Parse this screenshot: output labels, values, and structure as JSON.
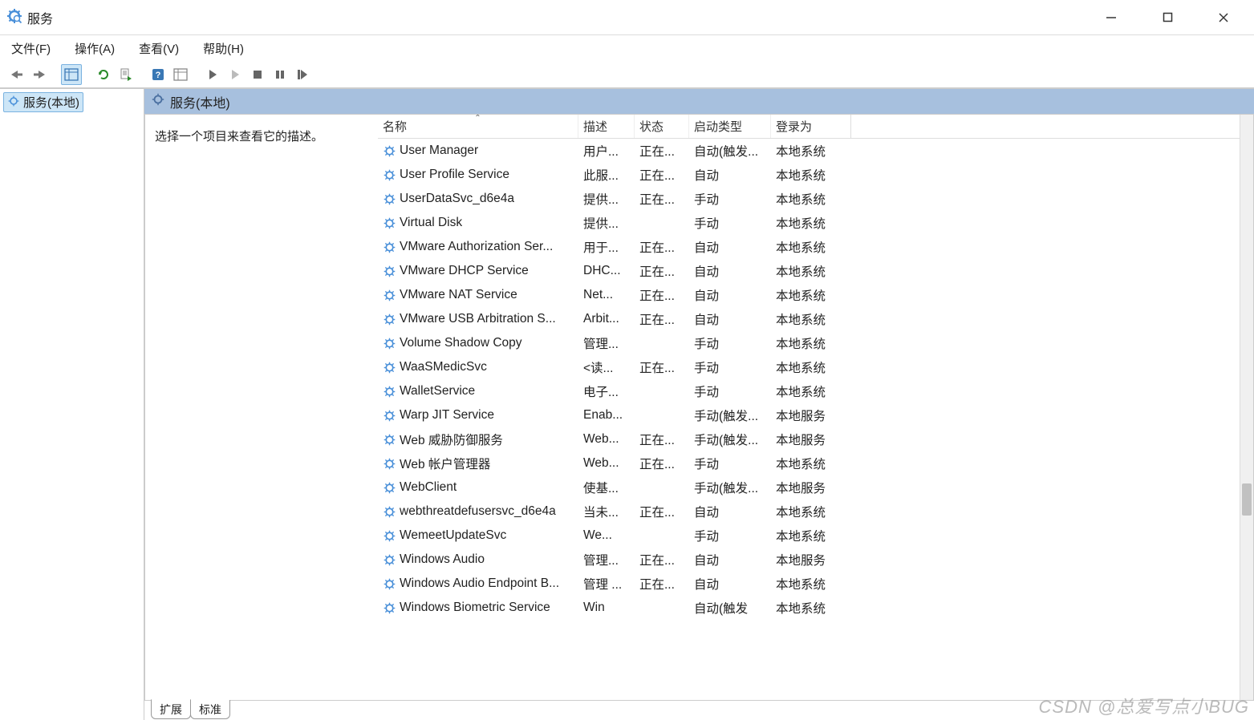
{
  "window": {
    "title": "服务"
  },
  "menubar": {
    "file": "文件(F)",
    "action": "操作(A)",
    "view": "查看(V)",
    "help": "帮助(H)"
  },
  "tree": {
    "root": "服务(本地)"
  },
  "content": {
    "header": "服务(本地)",
    "desc_prompt": "选择一个项目来查看它的描述。"
  },
  "columns": {
    "name": "名称",
    "desc": "描述",
    "status": "状态",
    "start": "启动类型",
    "logon": "登录为"
  },
  "services": [
    {
      "name": "User Manager",
      "desc": "用户...",
      "status": "正在...",
      "start": "自动(触发...",
      "logon": "本地系统"
    },
    {
      "name": "User Profile Service",
      "desc": "此服...",
      "status": "正在...",
      "start": "自动",
      "logon": "本地系统"
    },
    {
      "name": "UserDataSvc_d6e4a",
      "desc": "提供...",
      "status": "正在...",
      "start": "手动",
      "logon": "本地系统"
    },
    {
      "name": "Virtual Disk",
      "desc": "提供...",
      "status": "",
      "start": "手动",
      "logon": "本地系统"
    },
    {
      "name": "VMware Authorization Ser...",
      "desc": "用于...",
      "status": "正在...",
      "start": "自动",
      "logon": "本地系统"
    },
    {
      "name": "VMware DHCP Service",
      "desc": "DHC...",
      "status": "正在...",
      "start": "自动",
      "logon": "本地系统"
    },
    {
      "name": "VMware NAT Service",
      "desc": "Net...",
      "status": "正在...",
      "start": "自动",
      "logon": "本地系统"
    },
    {
      "name": "VMware USB Arbitration S...",
      "desc": "Arbit...",
      "status": "正在...",
      "start": "自动",
      "logon": "本地系统"
    },
    {
      "name": "Volume Shadow Copy",
      "desc": "管理...",
      "status": "",
      "start": "手动",
      "logon": "本地系统"
    },
    {
      "name": "WaaSMedicSvc",
      "desc": "<读...",
      "status": "正在...",
      "start": "手动",
      "logon": "本地系统"
    },
    {
      "name": "WalletService",
      "desc": "电子...",
      "status": "",
      "start": "手动",
      "logon": "本地系统"
    },
    {
      "name": "Warp JIT Service",
      "desc": "Enab...",
      "status": "",
      "start": "手动(触发...",
      "logon": "本地服务"
    },
    {
      "name": "Web 威胁防御服务",
      "desc": "Web...",
      "status": "正在...",
      "start": "手动(触发...",
      "logon": "本地服务"
    },
    {
      "name": "Web 帐户管理器",
      "desc": "Web...",
      "status": "正在...",
      "start": "手动",
      "logon": "本地系统"
    },
    {
      "name": "WebClient",
      "desc": "使基...",
      "status": "",
      "start": "手动(触发...",
      "logon": "本地服务"
    },
    {
      "name": "webthreatdefusersvc_d6e4a",
      "desc": "当未...",
      "status": "正在...",
      "start": "自动",
      "logon": "本地系统"
    },
    {
      "name": "WemeetUpdateSvc",
      "desc": "We...",
      "status": "",
      "start": "手动",
      "logon": "本地系统"
    },
    {
      "name": "Windows Audio",
      "desc": "管理...",
      "status": "正在...",
      "start": "自动",
      "logon": "本地服务"
    },
    {
      "name": "Windows Audio Endpoint B...",
      "desc": "管理 ...",
      "status": "正在...",
      "start": "自动",
      "logon": "本地系统"
    },
    {
      "name": "Windows Biometric Service",
      "desc": "Win",
      "status": "",
      "start": "自动(触发",
      "logon": "本地系统"
    }
  ],
  "tabs": {
    "extended": "扩展",
    "standard": "标准"
  },
  "watermark": "CSDN @总爱写点小BUG"
}
